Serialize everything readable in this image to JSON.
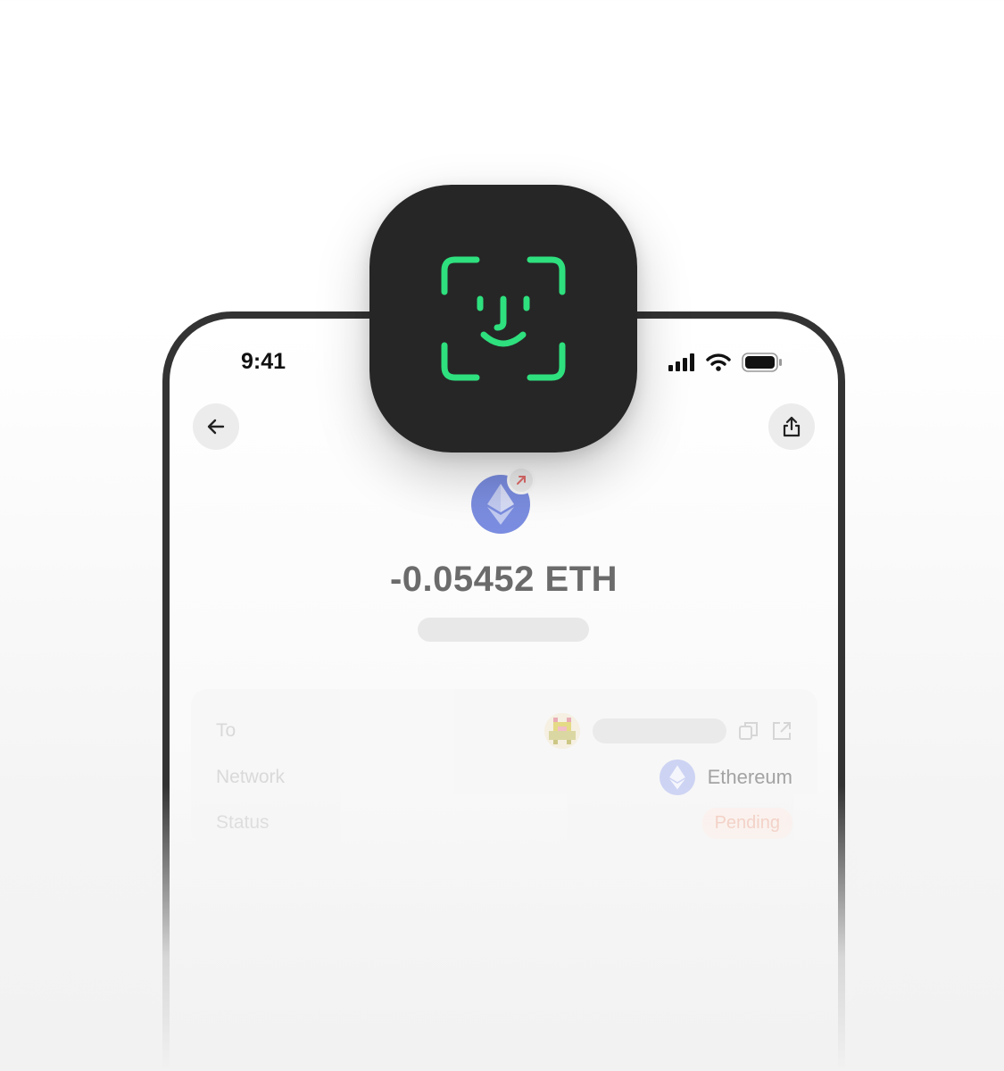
{
  "status_bar": {
    "time": "9:41",
    "icons": [
      "signal-icon",
      "wifi-icon",
      "battery-icon"
    ]
  },
  "header": {
    "back_icon": "arrow-left-icon",
    "share_icon": "share-icon"
  },
  "transaction": {
    "token_icon": "ethereum-icon",
    "direction_badge_icon": "arrow-up-right-icon",
    "amount": "-0.05452 ETH"
  },
  "details": {
    "to": {
      "label": "To",
      "icons": [
        "copy-icon",
        "external-link-icon"
      ]
    },
    "network": {
      "label": "Network",
      "value": "Ethereum"
    },
    "status": {
      "label": "Status",
      "value": "Pending"
    }
  },
  "overlay": {
    "icon": "face-id-icon"
  },
  "colors": {
    "face_id_green": "#2ee07e",
    "face_id_bg": "#262626",
    "eth_blue": "#7b8de0",
    "pending_text": "#f3c6b8",
    "send_badge_arrow": "#e06b6b"
  }
}
